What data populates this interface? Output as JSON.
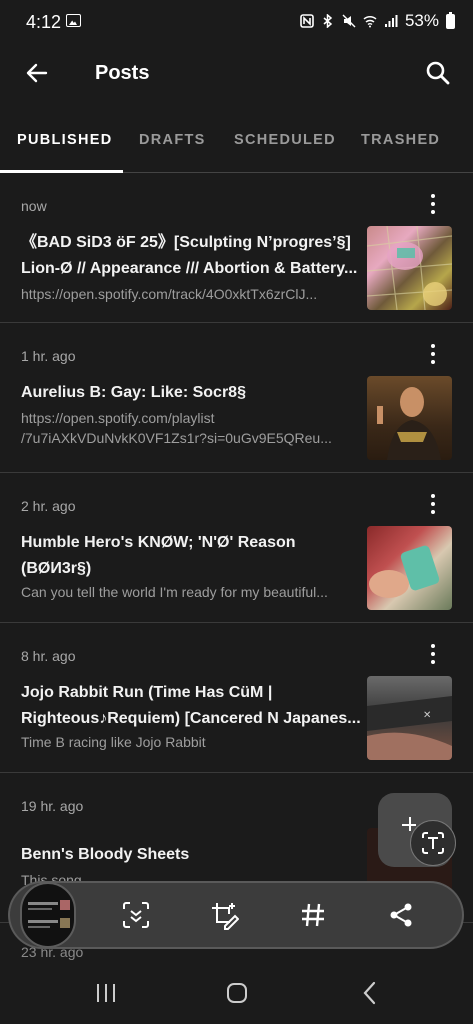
{
  "status": {
    "time": "4:12",
    "battery": "53%"
  },
  "appbar": {
    "title": "Posts"
  },
  "tabs": [
    {
      "label": "PUBLISHED",
      "active": true
    },
    {
      "label": "DRAFTS"
    },
    {
      "label": "SCHEDULED"
    },
    {
      "label": "TRASHED"
    }
  ],
  "posts": [
    {
      "time": "now",
      "title": [
        "《BAD SiD3 öF 25》[Sculpting N’progres’§]",
        "Lion-Ø // Appearance /// Abortion & Battery..."
      ],
      "subtitle": [
        "https://open.spotify.com/track/4O0xktTx6zrClJ..."
      ]
    },
    {
      "time": "1 hr. ago",
      "title": [
        "Aurelius B: Gay: Like: Socr8§"
      ],
      "subtitle": [
        "https://open.spotify.com/playlist",
        "/7u7iAXkVDuNvkK0VF1Zs1r?si=0uGv9E5QReu..."
      ]
    },
    {
      "time": "2 hr. ago",
      "title": [
        "Humble Hero's KNØW; 'N'Ø' Reason",
        "(BØИ3r§)"
      ],
      "subtitle": [
        "Can you tell the world I'm ready for my beautiful..."
      ]
    },
    {
      "time": "8 hr. ago",
      "title": [
        "Jojo Rabbit Run (Time Has CüM |",
        "Righteous♪Requiem) [Cancered N Japanes..."
      ],
      "subtitle": [
        "Time B racing like Jojo Rabbit"
      ]
    },
    {
      "time": "19 hr. ago",
      "title": [
        "Benn's Bloody Sheets"
      ],
      "subtitle": [
        "This song..."
      ]
    }
  ],
  "next_post_time": "23 hr. ago",
  "colors": {
    "background": "#1b1b1b",
    "divider": "#3a3a3a",
    "muted": "#9e9e9e"
  }
}
